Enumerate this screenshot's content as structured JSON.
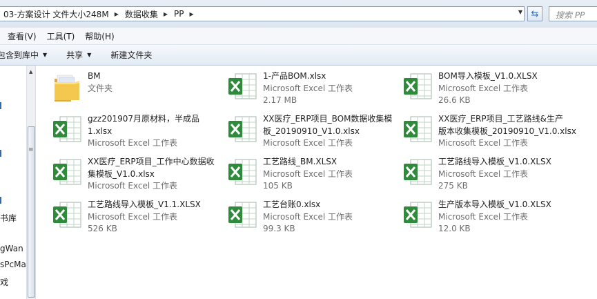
{
  "address": {
    "crumbs": [
      "03-方案设计 文件大小248M",
      "数据收集",
      "PP"
    ],
    "search_placeholder": "搜索 PP"
  },
  "menu": {
    "items": [
      "查看(V)",
      "工具(T)",
      "帮助(H)"
    ]
  },
  "toolbar": {
    "include_label": "包含到库中",
    "share_label": "共享",
    "new_folder_label": "新建文件夹"
  },
  "nav": {
    "items": [
      "书库",
      "gWan",
      "sPcMa",
      "戏"
    ]
  },
  "files": [
    {
      "name": "BM",
      "type": "文件夹",
      "size": "",
      "icon": "folder-icon"
    },
    {
      "name": "1-产品BOM.xlsx",
      "type": "Microsoft Excel 工作表",
      "size": "2.17 MB",
      "icon": "excel-icon"
    },
    {
      "name": "BOM导入模板_V1.0.XLSX",
      "type": "Microsoft Excel 工作表",
      "size": "26.6 KB",
      "icon": "excel-icon"
    },
    {
      "name": "gzz201907月原材料，半成品\n1.xlsx",
      "type": "Microsoft Excel 工作表",
      "size": "",
      "icon": "excel-icon"
    },
    {
      "name": "XX医疗_ERP项目_BOM数据收集模\n板_20190910_V1.0.xlsx",
      "type": "Microsoft Excel 工作表",
      "size": "",
      "icon": "excel-icon"
    },
    {
      "name": "XX医疗_ERP项目_工艺路线&生产\n版本收集模板_20190910_V1.0.xlsx",
      "type": "Microsoft Excel 工作表",
      "size": "",
      "icon": "excel-icon"
    },
    {
      "name": "XX医疗_ERP项目_工作中心数据收\n集模板_V1.0.xlsx",
      "type": "Microsoft Excel 工作表",
      "size": "",
      "icon": "excel-icon"
    },
    {
      "name": "工艺路线_BM.XLSX",
      "type": "Microsoft Excel 工作表",
      "size": "105 KB",
      "icon": "excel-icon"
    },
    {
      "name": "工艺路线导入模板_V1.0.XLSX",
      "type": "Microsoft Excel 工作表",
      "size": "275 KB",
      "icon": "excel-icon"
    },
    {
      "name": "工艺路线导入模板_V1.1.XLSX",
      "type": "Microsoft Excel 工作表",
      "size": "526 KB",
      "icon": "excel-icon"
    },
    {
      "name": "工艺台账0.xlsx",
      "type": "Microsoft Excel 工作表",
      "size": "99.3 KB",
      "icon": "excel-icon"
    },
    {
      "name": "生产版本导入模板_V1.0.XLSX",
      "type": "Microsoft Excel 工作表",
      "size": "12.0 KB",
      "icon": "excel-icon"
    }
  ]
}
